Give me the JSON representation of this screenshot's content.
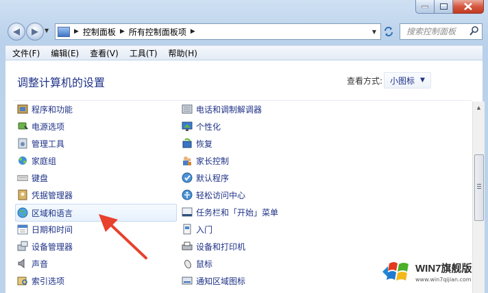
{
  "navbar": {
    "breadcrumb": [
      "控制面板",
      "所有控制面板项"
    ],
    "search_placeholder": "搜索控制面板"
  },
  "menu": [
    "文件(F)",
    "编辑(E)",
    "查看(V)",
    "工具(T)",
    "帮助(H)"
  ],
  "header": {
    "title": "调整计算机的设置",
    "view_by_label": "查看方式:",
    "view_by_value": "小图标"
  },
  "items_left": [
    {
      "label": "程序和功能",
      "icon": "programs-icon"
    },
    {
      "label": "电源选项",
      "icon": "power-icon"
    },
    {
      "label": "管理工具",
      "icon": "admin-tools-icon"
    },
    {
      "label": "家庭组",
      "icon": "homegroup-icon"
    },
    {
      "label": "键盘",
      "icon": "keyboard-icon"
    },
    {
      "label": "凭据管理器",
      "icon": "credential-icon"
    },
    {
      "label": "区域和语言",
      "icon": "region-language-icon",
      "selected": true
    },
    {
      "label": "日期和时间",
      "icon": "calendar-icon"
    },
    {
      "label": "设备管理器",
      "icon": "device-manager-icon"
    },
    {
      "label": "声音",
      "icon": "speaker-icon"
    },
    {
      "label": "索引选项",
      "icon": "indexing-icon"
    }
  ],
  "items_right": [
    {
      "label": "电话和调制解调器",
      "icon": "phone-modem-icon"
    },
    {
      "label": "个性化",
      "icon": "personalization-icon"
    },
    {
      "label": "恢复",
      "icon": "recovery-icon"
    },
    {
      "label": "家长控制",
      "icon": "parental-icon"
    },
    {
      "label": "默认程序",
      "icon": "default-programs-icon"
    },
    {
      "label": "轻松访问中心",
      "icon": "ease-of-access-icon"
    },
    {
      "label": "任务栏和「开始」菜单",
      "icon": "taskbar-icon"
    },
    {
      "label": "入门",
      "icon": "getting-started-icon"
    },
    {
      "label": "设备和打印机",
      "icon": "printer-icon"
    },
    {
      "label": "鼠标",
      "icon": "mouse-icon"
    },
    {
      "label": "通知区域图标",
      "icon": "notification-icon"
    }
  ],
  "watermark": {
    "title": "WIN7旗舰版",
    "url": "www.win7qijian.com"
  },
  "colors": {
    "link": "#1e3287",
    "arrow": "#e8412d"
  }
}
